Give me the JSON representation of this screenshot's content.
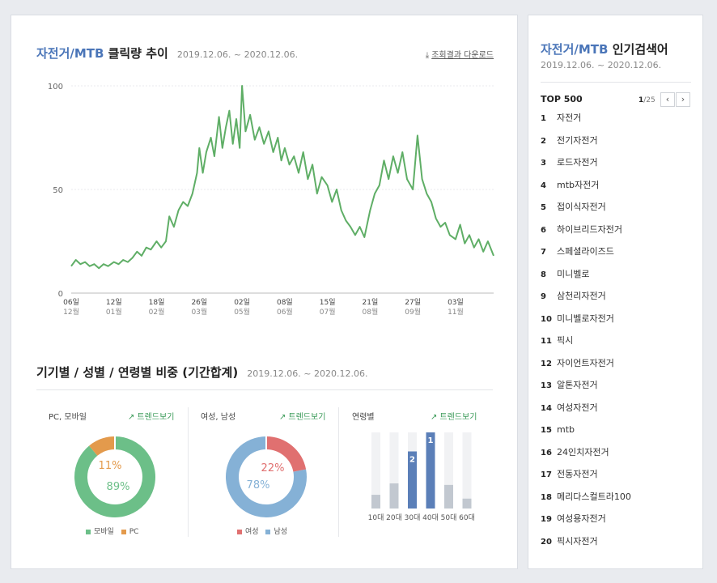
{
  "header": {
    "keyword": "자전거/MTB",
    "title": "클릭량 추이",
    "date_range": "2019.12.06. ~ 2020.12.06.",
    "download_label": "조회결과 다운로드"
  },
  "section2": {
    "title": "기기별 / 성별 / 연령별 비중 (기간합계)",
    "date_range": "2019.12.06. ~ 2020.12.06.",
    "trend_label": "트렌드보기"
  },
  "sidebar": {
    "keyword": "자전거/MTB",
    "title": "인기검색어",
    "date_range": "2019.12.06. ~ 2020.12.06.",
    "top_label": "TOP 500",
    "page_current": "1",
    "page_total": "/25",
    "prev_icon": "‹",
    "next_icon": "›",
    "items": [
      {
        "rank": "1",
        "keyword": "자전거"
      },
      {
        "rank": "2",
        "keyword": "전기자전거"
      },
      {
        "rank": "3",
        "keyword": "로드자전거"
      },
      {
        "rank": "4",
        "keyword": "mtb자전거"
      },
      {
        "rank": "5",
        "keyword": "접이식자전거"
      },
      {
        "rank": "6",
        "keyword": "하이브리드자전거"
      },
      {
        "rank": "7",
        "keyword": "스페셜라이즈드"
      },
      {
        "rank": "8",
        "keyword": "미니벨로"
      },
      {
        "rank": "9",
        "keyword": "삼천리자전거"
      },
      {
        "rank": "10",
        "keyword": "미니벨로자전거"
      },
      {
        "rank": "11",
        "keyword": "픽시"
      },
      {
        "rank": "12",
        "keyword": "자이언트자전거"
      },
      {
        "rank": "13",
        "keyword": "알톤자전거"
      },
      {
        "rank": "14",
        "keyword": "여성자전거"
      },
      {
        "rank": "15",
        "keyword": "mtb"
      },
      {
        "rank": "16",
        "keyword": "24인치자전거"
      },
      {
        "rank": "17",
        "keyword": "전동자전거"
      },
      {
        "rank": "18",
        "keyword": "메리다스컬트라100"
      },
      {
        "rank": "19",
        "keyword": "여성용자전거"
      },
      {
        "rank": "20",
        "keyword": "픽시자전거"
      }
    ]
  },
  "colors": {
    "accent": "#4a75b8",
    "line": "#5fae66",
    "mobile": "#6cbf88",
    "pc": "#e39a4c",
    "female": "#e07070",
    "male": "#85b1d6",
    "age_bar_bg": "#f1f2f4",
    "age_bar_fill": "#c2c8d0",
    "age_bar_highlight": "#5b7fb8",
    "trend": "#3a9a58"
  },
  "chart_data": [
    {
      "type": "line",
      "title": "클릭량 추이",
      "ylim": [
        0,
        100
      ],
      "yticks": [
        "0",
        "50",
        "100"
      ],
      "x_ticks": [
        {
          "day": "06일",
          "month": "12월",
          "date": "2019-12-06"
        },
        {
          "day": "12일",
          "month": "01월",
          "date": "2020-01-12"
        },
        {
          "day": "18일",
          "month": "02월",
          "date": "2020-02-18"
        },
        {
          "day": "26일",
          "month": "03월",
          "date": "2020-03-26"
        },
        {
          "day": "02일",
          "month": "05월",
          "date": "2020-05-02"
        },
        {
          "day": "08일",
          "month": "06월",
          "date": "2020-06-08"
        },
        {
          "day": "15일",
          "month": "07월",
          "date": "2020-07-15"
        },
        {
          "day": "21일",
          "month": "08월",
          "date": "2020-08-21"
        },
        {
          "day": "27일",
          "month": "09월",
          "date": "2020-09-27"
        },
        {
          "day": "03일",
          "month": "11월",
          "date": "2020-11-03"
        }
      ],
      "x_range": [
        "2019-12-06",
        "2020-12-06"
      ],
      "series": [
        {
          "points": [
            [
              "2019-12-06",
              13
            ],
            [
              "2019-12-10",
              16
            ],
            [
              "2019-12-14",
              14
            ],
            [
              "2019-12-18",
              15
            ],
            [
              "2019-12-22",
              13
            ],
            [
              "2019-12-26",
              14
            ],
            [
              "2019-12-30",
              12
            ],
            [
              "2020-01-03",
              14
            ],
            [
              "2020-01-07",
              13
            ],
            [
              "2020-01-12",
              15
            ],
            [
              "2020-01-16",
              14
            ],
            [
              "2020-01-20",
              16
            ],
            [
              "2020-01-24",
              15
            ],
            [
              "2020-01-28",
              17
            ],
            [
              "2020-02-01",
              20
            ],
            [
              "2020-02-05",
              18
            ],
            [
              "2020-02-09",
              22
            ],
            [
              "2020-02-13",
              21
            ],
            [
              "2020-02-18",
              25
            ],
            [
              "2020-02-22",
              22
            ],
            [
              "2020-02-26",
              25
            ],
            [
              "2020-02-29",
              37
            ],
            [
              "2020-03-04",
              32
            ],
            [
              "2020-03-08",
              40
            ],
            [
              "2020-03-12",
              44
            ],
            [
              "2020-03-16",
              42
            ],
            [
              "2020-03-20",
              48
            ],
            [
              "2020-03-24",
              58
            ],
            [
              "2020-03-26",
              70
            ],
            [
              "2020-03-29",
              58
            ],
            [
              "2020-04-01",
              68
            ],
            [
              "2020-04-05",
              75
            ],
            [
              "2020-04-08",
              66
            ],
            [
              "2020-04-12",
              85
            ],
            [
              "2020-04-15",
              70
            ],
            [
              "2020-04-18",
              80
            ],
            [
              "2020-04-21",
              88
            ],
            [
              "2020-04-24",
              72
            ],
            [
              "2020-04-27",
              84
            ],
            [
              "2020-04-30",
              70
            ],
            [
              "2020-05-02",
              100
            ],
            [
              "2020-05-05",
              78
            ],
            [
              "2020-05-09",
              86
            ],
            [
              "2020-05-13",
              74
            ],
            [
              "2020-05-17",
              80
            ],
            [
              "2020-05-21",
              72
            ],
            [
              "2020-05-25",
              78
            ],
            [
              "2020-05-29",
              68
            ],
            [
              "2020-06-02",
              75
            ],
            [
              "2020-06-05",
              64
            ],
            [
              "2020-06-08",
              70
            ],
            [
              "2020-06-12",
              62
            ],
            [
              "2020-06-16",
              66
            ],
            [
              "2020-06-20",
              58
            ],
            [
              "2020-06-24",
              68
            ],
            [
              "2020-06-28",
              55
            ],
            [
              "2020-07-02",
              62
            ],
            [
              "2020-07-06",
              48
            ],
            [
              "2020-07-10",
              56
            ],
            [
              "2020-07-15",
              52
            ],
            [
              "2020-07-19",
              44
            ],
            [
              "2020-07-23",
              50
            ],
            [
              "2020-07-27",
              40
            ],
            [
              "2020-07-31",
              35
            ],
            [
              "2020-08-04",
              32
            ],
            [
              "2020-08-08",
              28
            ],
            [
              "2020-08-12",
              32
            ],
            [
              "2020-08-16",
              27
            ],
            [
              "2020-08-21",
              40
            ],
            [
              "2020-08-25",
              48
            ],
            [
              "2020-08-29",
              52
            ],
            [
              "2020-09-02",
              64
            ],
            [
              "2020-09-06",
              55
            ],
            [
              "2020-09-10",
              66
            ],
            [
              "2020-09-14",
              58
            ],
            [
              "2020-09-18",
              68
            ],
            [
              "2020-09-22",
              55
            ],
            [
              "2020-09-27",
              50
            ],
            [
              "2020-10-01",
              76
            ],
            [
              "2020-10-05",
              55
            ],
            [
              "2020-10-09",
              48
            ],
            [
              "2020-10-13",
              44
            ],
            [
              "2020-10-17",
              36
            ],
            [
              "2020-10-21",
              32
            ],
            [
              "2020-10-25",
              34
            ],
            [
              "2020-10-29",
              28
            ],
            [
              "2020-11-03",
              26
            ],
            [
              "2020-11-07",
              33
            ],
            [
              "2020-11-11",
              24
            ],
            [
              "2020-11-15",
              28
            ],
            [
              "2020-11-19",
              22
            ],
            [
              "2020-11-23",
              26
            ],
            [
              "2020-11-27",
              20
            ],
            [
              "2020-12-01",
              25
            ],
            [
              "2020-12-06",
              18
            ]
          ]
        }
      ],
      "grid": true
    },
    {
      "type": "pie",
      "title": "PC, 모바일",
      "labels": [
        "모바일",
        "PC"
      ],
      "values": [
        89,
        11
      ],
      "value_labels": [
        "89%",
        "11%"
      ]
    },
    {
      "type": "pie",
      "title": "여성, 남성",
      "labels": [
        "여성",
        "남성"
      ],
      "values": [
        22,
        78
      ],
      "value_labels": [
        "22%",
        "78%"
      ]
    },
    {
      "type": "bar",
      "title": "연령별",
      "categories": [
        "10대",
        "20대",
        "30대",
        "40대",
        "50대",
        "60대"
      ],
      "values": [
        0.18,
        0.33,
        0.75,
        1.0,
        0.31,
        0.13
      ],
      "ranks": [
        "",
        "",
        "2",
        "1",
        "",
        ""
      ]
    }
  ]
}
